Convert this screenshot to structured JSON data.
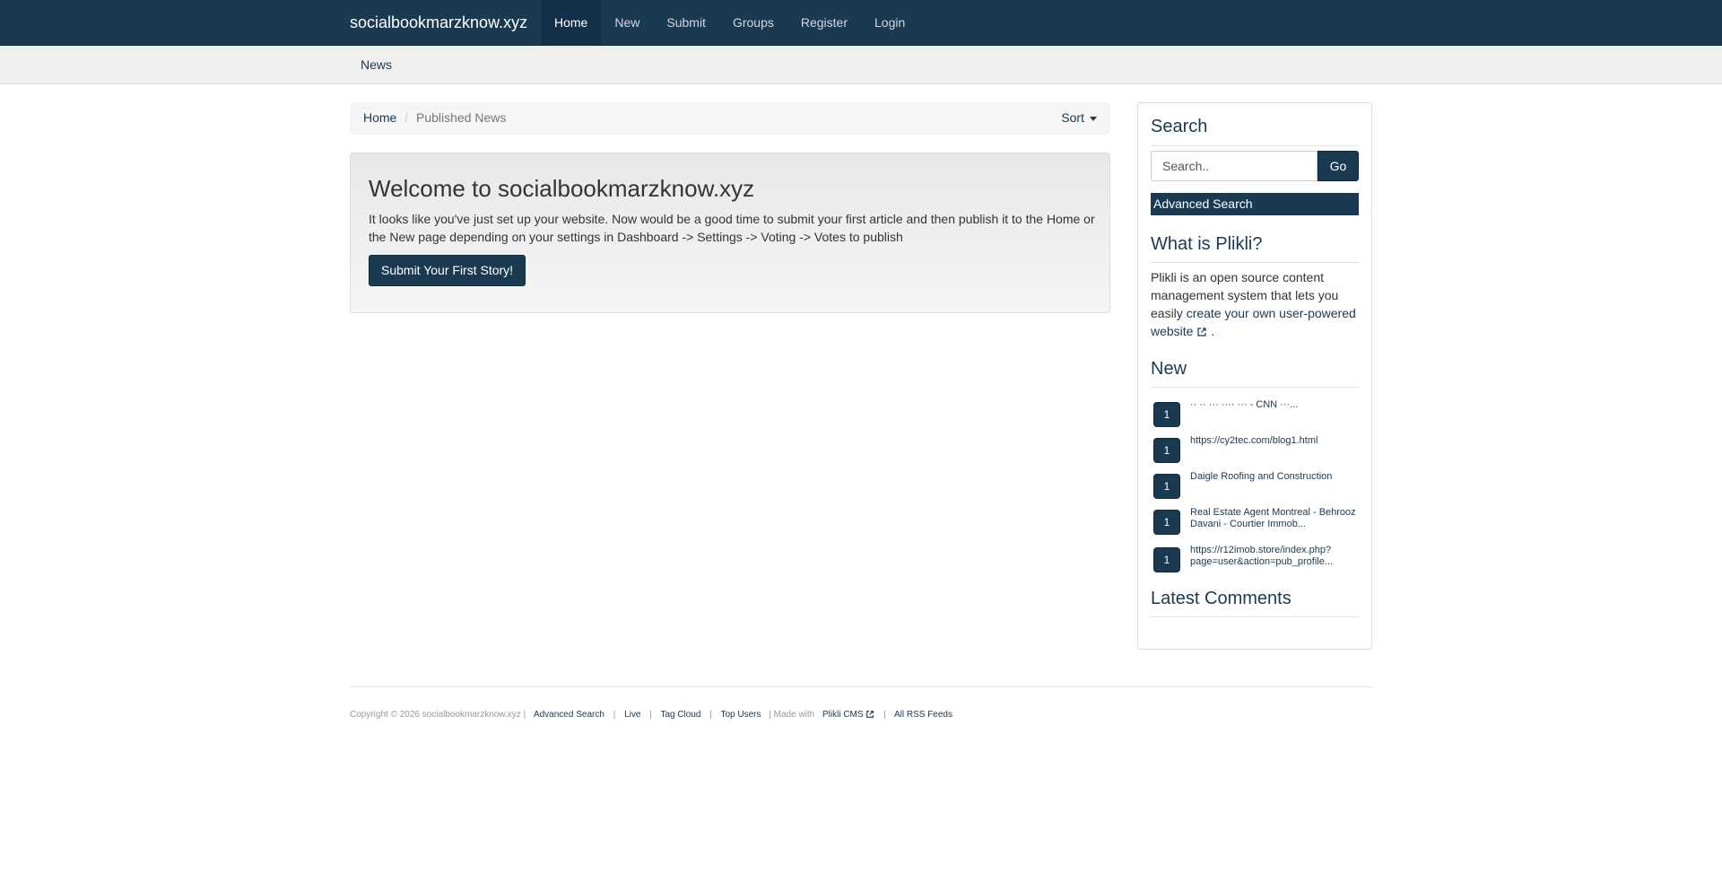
{
  "brand": "socialbookmarzknow.xyz",
  "nav": {
    "items": [
      {
        "label": "Home"
      },
      {
        "label": "New"
      },
      {
        "label": "Submit"
      },
      {
        "label": "Groups"
      },
      {
        "label": "Register"
      },
      {
        "label": "Login"
      }
    ]
  },
  "subnav": {
    "label": "News"
  },
  "breadcrumb": {
    "home": "Home",
    "separator": "/",
    "current": "Published News",
    "sort": "Sort"
  },
  "welcome": {
    "title": "Welcome to socialbookmarzknow.xyz",
    "text": "It looks like you've just set up your website. Now would be a good time to submit your first article and then publish it to the Home or the New page depending on your settings in Dashboard -> Settings -> Voting -> Votes to publish",
    "button": "Submit Your First Story!"
  },
  "sidebar": {
    "search_title": "Search",
    "search_placeholder": "Search..",
    "go_label": "Go",
    "advanced_search": "Advanced Search",
    "about_title": "What is Plikli?",
    "about_text": "Plikli is an open source content management system that lets you easily",
    "about_link": "create your own user-powered website",
    "about_end": ".",
    "new_title": "New",
    "new_items": [
      {
        "votes": "1",
        "title": "·· ·· ··· ···· ··· - CNN ···..."
      },
      {
        "votes": "1",
        "title": "https://cy2tec.com/blog1.html"
      },
      {
        "votes": "1",
        "title": "Daigle Roofing and Construction"
      },
      {
        "votes": "1",
        "title": "Real Estate Agent Montreal - Behrooz Davani - Courtier Immob..."
      },
      {
        "votes": "1",
        "title": "https://r12imob.store/index.php?page=user&action=pub_profile..."
      }
    ],
    "comments_title": "Latest Comments"
  },
  "footer": {
    "copyright": "Copyright © 2026 socialbookmarzknow.xyz |",
    "advanced_search": "Advanced Search",
    "live": "Live",
    "tag_cloud": "Tag Cloud",
    "top_users": "Top Users",
    "made_with": "| Made with",
    "plikli_cms": "Plikli CMS",
    "rss": "All RSS Feeds",
    "pipe": "|"
  },
  "colors": {
    "primary": "#1a3a52",
    "subnav_bg": "#efefef",
    "panel_bg": "#f5f5f5"
  },
  "icons": {
    "external_link": "external-link-icon",
    "caret": "caret-down-icon"
  }
}
